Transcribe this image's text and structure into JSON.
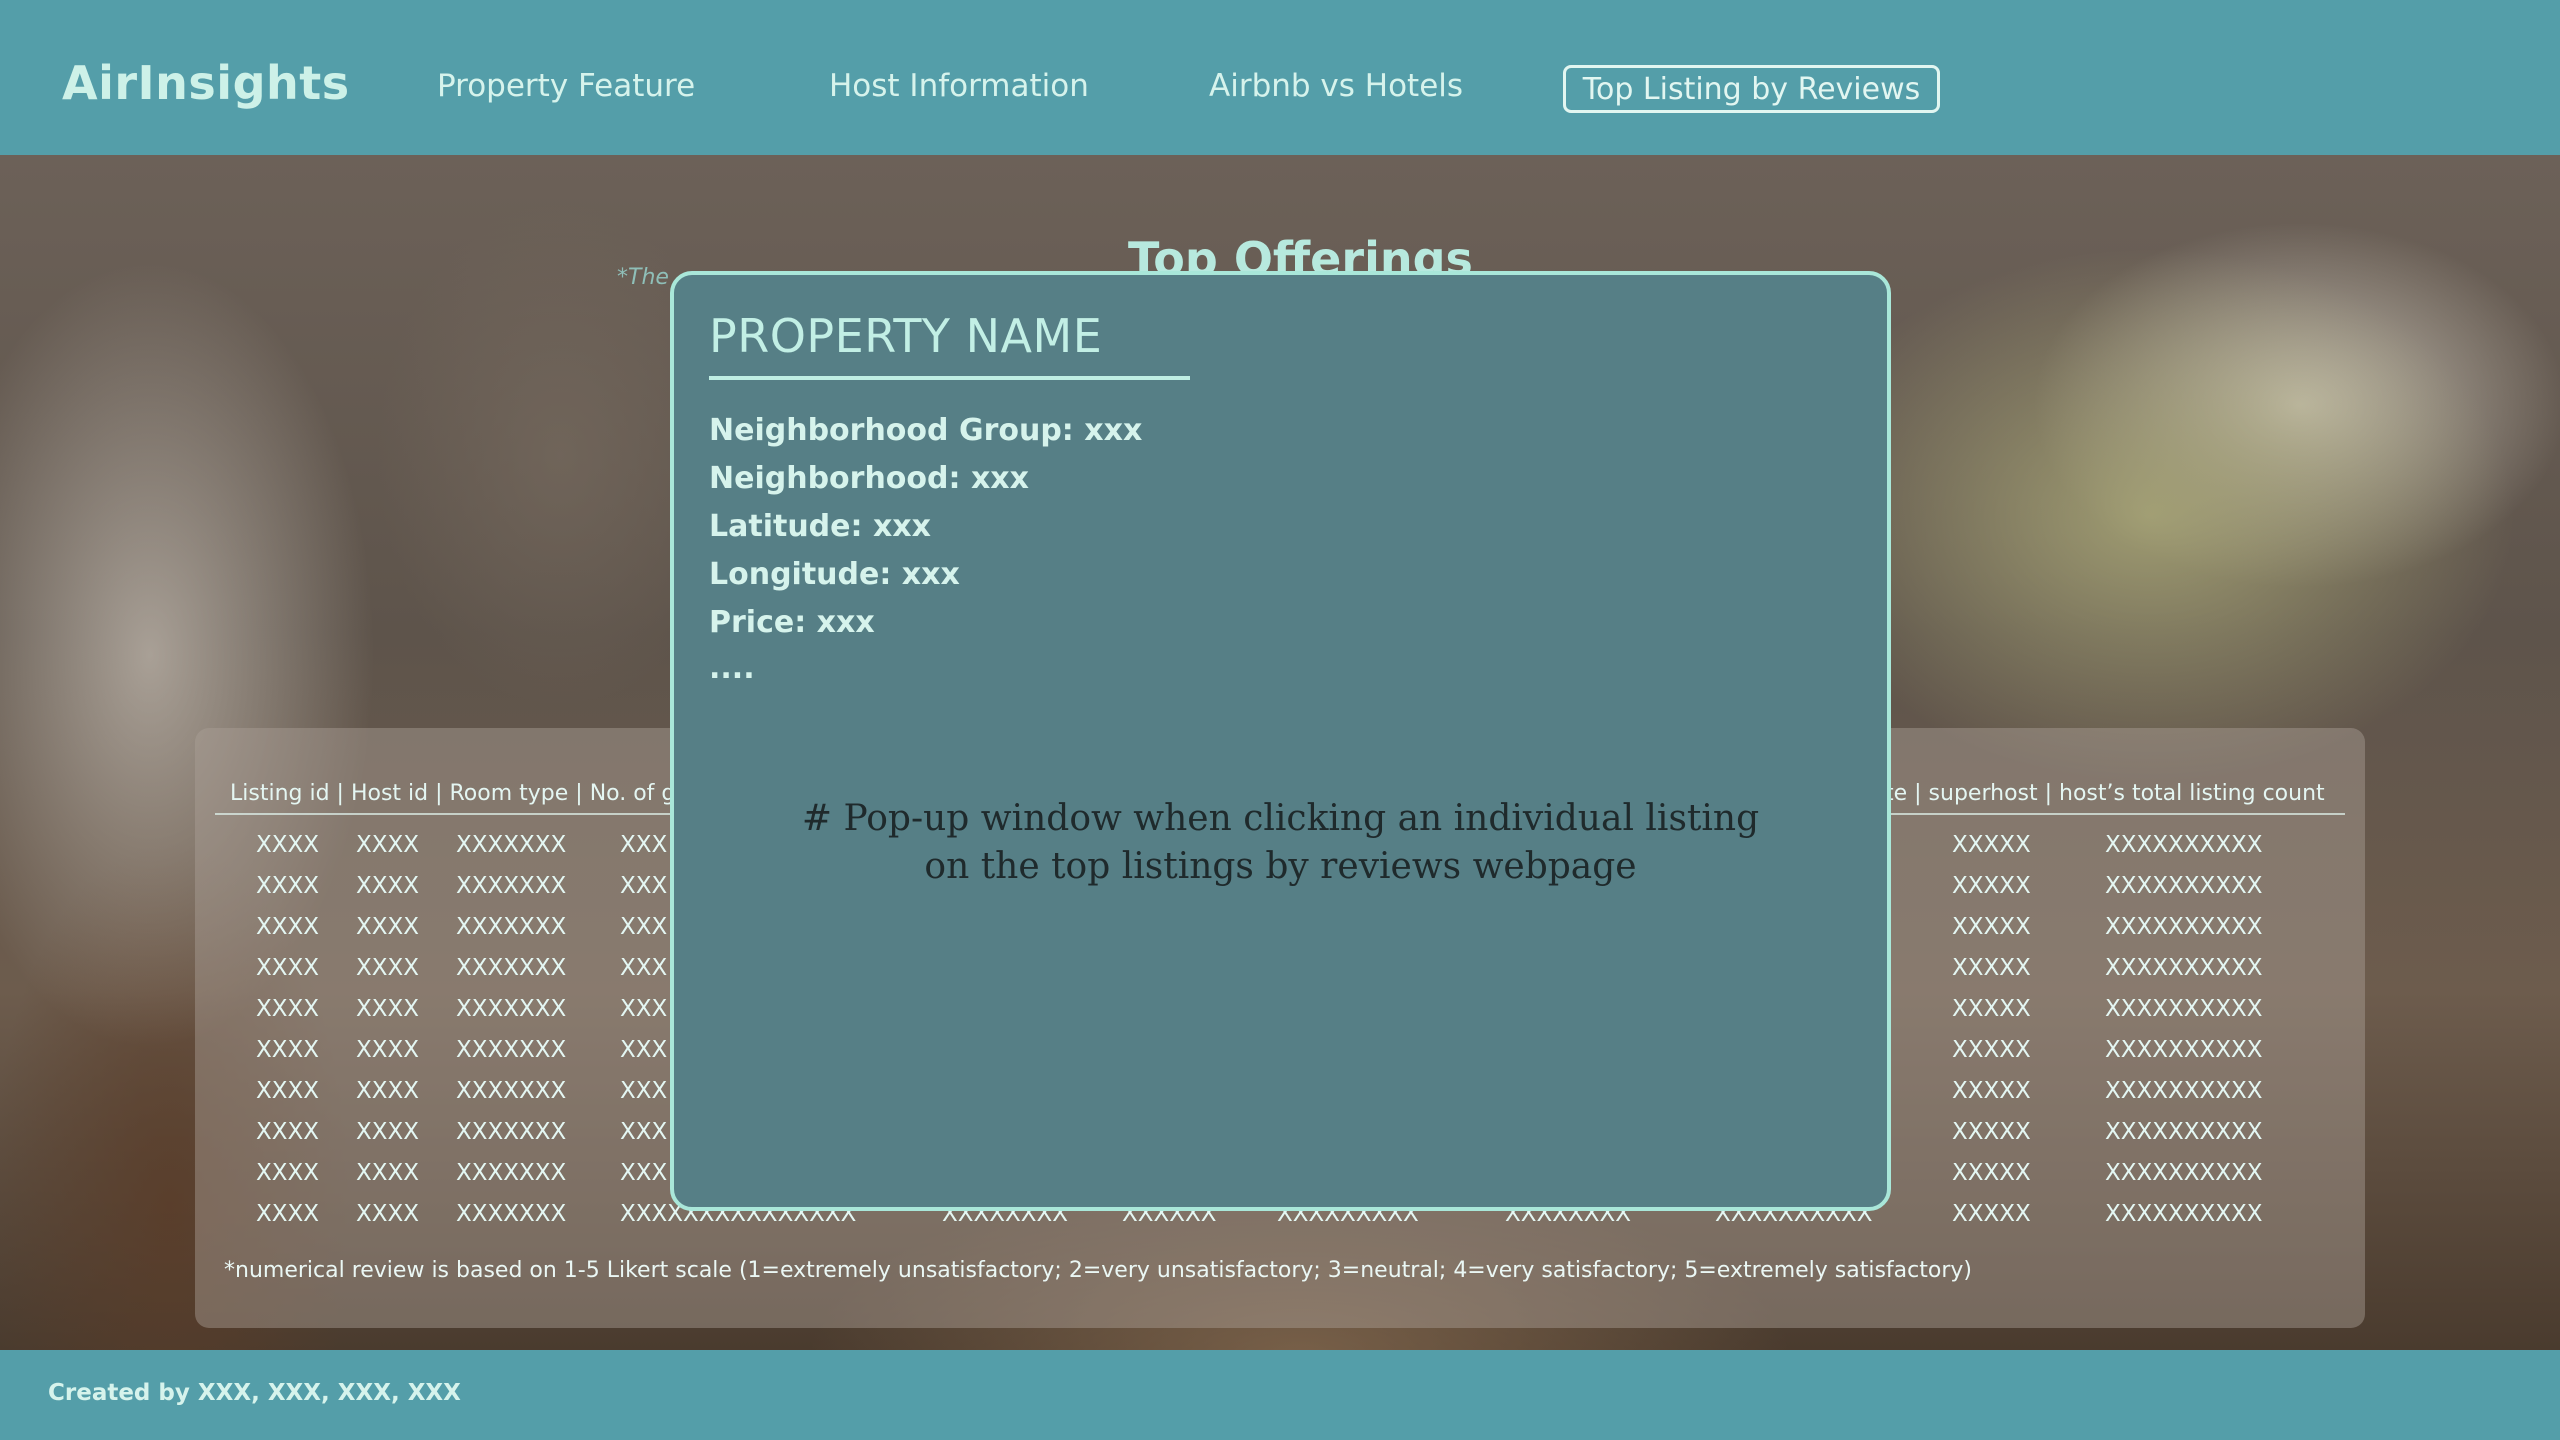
{
  "header": {
    "logo": "AirInsights",
    "nav": [
      {
        "label": "Property Feature"
      },
      {
        "label": "Host Information"
      },
      {
        "label": "Airbnb vs Hotels"
      },
      {
        "label": "Top Listing by Reviews"
      }
    ]
  },
  "section": {
    "title": "Top Offerings",
    "note": "*The"
  },
  "table": {
    "header_left": "Listing id | Host id | Room type | No. of gu",
    "header_right": "te  | superhost | host’s total listing count",
    "rows": [
      [
        "XXXX",
        "XXXX",
        "XXXXXXX",
        "XXX",
        "XXXXX",
        "XXXXXXXXXX"
      ],
      [
        "XXXX",
        "XXXX",
        "XXXXXXX",
        "XXX",
        "XXXXX",
        "XXXXXXXXXX"
      ],
      [
        "XXXX",
        "XXXX",
        "XXXXXXX",
        "XXX",
        "XXXXX",
        "XXXXXXXXXX"
      ],
      [
        "XXXX",
        "XXXX",
        "XXXXXXX",
        "XXX",
        "XXXXX",
        "XXXXXXXXXX"
      ],
      [
        "XXXX",
        "XXXX",
        "XXXXXXX",
        "XXX",
        "XXXXX",
        "XXXXXXXXXX"
      ],
      [
        "XXXX",
        "XXXX",
        "XXXXXXX",
        "XXX",
        "XXXXX",
        "XXXXXXXXXX"
      ],
      [
        "XXXX",
        "XXXX",
        "XXXXXXX",
        "XXX",
        "XXXXX",
        "XXXXXXXXXX"
      ],
      [
        "XXXX",
        "XXXX",
        "XXXXXXX",
        "XXX",
        "XXXXX",
        "XXXXXXXXXX"
      ],
      [
        "XXXX",
        "XXXX",
        "XXXXXXX",
        "XXX",
        "XXXXX",
        "XXXXXXXXXX"
      ]
    ],
    "last_row": [
      "XXXX",
      "XXXX",
      "XXXXXXX",
      "XXXXXXXXXXXXXXX",
      "XXXXXXXX",
      "XXXXXX",
      "XXXXXXXXX",
      "XXXXXXXX",
      "XXXXXXXXXX",
      "XXXXX",
      "XXXXXXXXXX"
    ],
    "footnote": "*numerical review is based on 1-5 Likert scale (1=extremely unsatisfactory; 2=very unsatisfactory; 3=neutral; 4=very satisfactory; 5=extremely satisfactory)"
  },
  "modal": {
    "title": "PROPERTY NAME",
    "fields": [
      "Neighborhood Group: xxx",
      "Neighborhood: xxx",
      "Latitude: xxx",
      "Longitude: xxx",
      "Price: xxx",
      "...."
    ],
    "note_line1": "# Pop-up window when clicking an individual listing",
    "note_line2": "on the top listings by reviews webpage"
  },
  "footer": {
    "credits": "Created by XXX, XXX, XXX, XXX"
  }
}
